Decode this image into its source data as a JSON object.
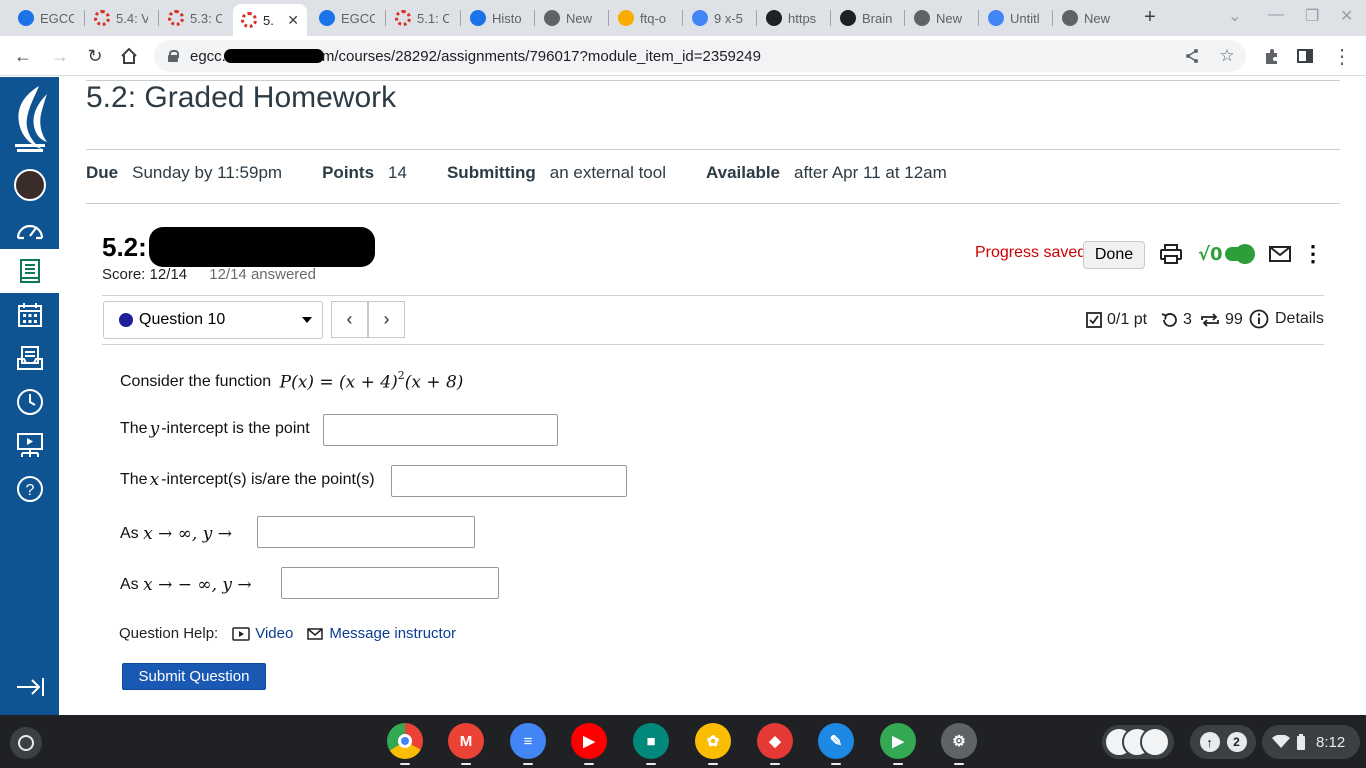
{
  "browser": {
    "tabs": [
      {
        "label": "EGCC",
        "favicon": "canvas-logo-icon",
        "color": "#1a73e8",
        "active": false
      },
      {
        "label": "5.4: V",
        "favicon": "myopenmath-icon",
        "color": "#d93025",
        "active": false
      },
      {
        "label": "5.3: C",
        "favicon": "myopenmath-icon",
        "color": "#d93025",
        "active": false
      },
      {
        "label": "5.",
        "favicon": "myopenmath-icon",
        "color": "#d93025",
        "active": true
      },
      {
        "label": "EGCC",
        "favicon": "canvas-logo-icon",
        "color": "#1a73e8",
        "active": false
      },
      {
        "label": "5.1: C",
        "favicon": "myopenmath-icon",
        "color": "#d93025",
        "active": false
      },
      {
        "label": "Histo",
        "favicon": "history-icon",
        "color": "#1a73e8",
        "active": false
      },
      {
        "label": "New",
        "favicon": "chrome-icon",
        "color": "#5f6368",
        "active": false
      },
      {
        "label": "ftq-o",
        "favicon": "file-icon",
        "color": "#f9ab00",
        "active": false
      },
      {
        "label": "9 x-5",
        "favicon": "google-icon",
        "color": "#4285f4",
        "active": false
      },
      {
        "label": "https",
        "favicon": "box-icon",
        "color": "#202124",
        "active": false
      },
      {
        "label": "Brain",
        "favicon": "brainly-icon",
        "color": "#202124",
        "active": false
      },
      {
        "label": "New",
        "favicon": "chrome-icon",
        "color": "#5f6368",
        "active": false
      },
      {
        "label": "Untitl",
        "favicon": "docs-icon",
        "color": "#4285f4",
        "active": false
      },
      {
        "label": "New",
        "favicon": "chrome-icon",
        "color": "#5f6368",
        "active": false
      }
    ],
    "url_host": "egcc.",
    "url_path": "m/courses/28292/assignments/796017?module_item_id=2359249"
  },
  "page": {
    "title": "5.2: Graded Homework",
    "details": [
      {
        "label": "Due",
        "value": "Sunday by 11:59pm"
      },
      {
        "label": "Points",
        "value": "14"
      },
      {
        "label": "Submitting",
        "value": "an external tool"
      },
      {
        "label": "Available",
        "value": "after Apr 11 at 12am"
      }
    ]
  },
  "mom": {
    "title_prefix": "5.2:",
    "score": "Score: 12/14",
    "answered": "12/14 answered",
    "progress": "Progress saved",
    "done_label": "Done",
    "question_select": "Question 10",
    "points": "0/1 pt",
    "retries": "3",
    "attempts": "99",
    "details_label": "Details",
    "accent_green": "#2e9e3a"
  },
  "question": {
    "intro": "Consider the function",
    "function": {
      "lhs": "P(x) = (x + 4)",
      "exp": "2",
      "rhs": "(x + 8)"
    },
    "yint_pre": "The ",
    "yint_var": "y",
    "yint_post": "-intercept is the point",
    "xint_pre": "The ",
    "xint_var": "x",
    "xint_post": "-intercept(s) is/are the point(s)",
    "as": "As",
    "limit_pos": "x → ∞, y →",
    "limit_neg": "x →  − ∞, y →",
    "answers": {
      "yint": "",
      "xint": "",
      "pos": "",
      "neg": ""
    },
    "help_label": "Question Help:",
    "video_label": "Video",
    "message_label": "Message instructor",
    "submit_label": "Submit Question"
  },
  "shelf": {
    "apps": [
      {
        "name": "chrome-app",
        "color": "#4285f4"
      },
      {
        "name": "gmail-app",
        "color": "#ea4335"
      },
      {
        "name": "docs-app",
        "color": "#4285f4"
      },
      {
        "name": "youtube-app",
        "color": "#ff0000"
      },
      {
        "name": "meet-app",
        "color": "#00897b"
      },
      {
        "name": "photos-app",
        "color": "#fbbc04"
      },
      {
        "name": "cube-app",
        "color": "#e53935"
      },
      {
        "name": "draw-app",
        "color": "#1e88e5"
      },
      {
        "name": "play-store-app",
        "color": "#34a853"
      },
      {
        "name": "settings-app",
        "color": "#5f6368"
      }
    ],
    "notification_count": "2",
    "time": "8:12"
  }
}
